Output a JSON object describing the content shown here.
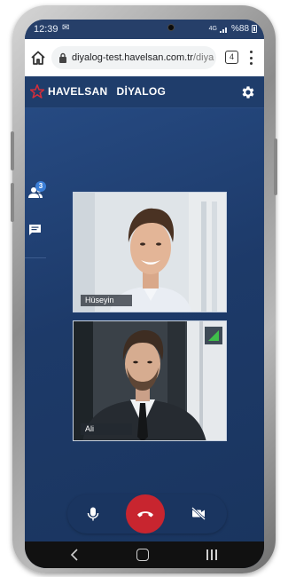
{
  "status_bar": {
    "time": "12:39",
    "message_indicator": "✉",
    "network": "4G",
    "battery": "%88"
  },
  "browser": {
    "url_host": "diyalog-test.havelsan.com.tr",
    "url_path": "/diya",
    "tab_count": "4"
  },
  "app": {
    "brand": "HAVELSAN",
    "product": "DİYALOG"
  },
  "sidebar": {
    "participants_count": "3"
  },
  "participants": [
    {
      "name": "Hüseyin"
    },
    {
      "name": "Ali"
    }
  ],
  "colors": {
    "app_background": "#1d3a66",
    "hangup": "#c8252f",
    "badge": "#3b7fd8",
    "signal": "#3fbf4a"
  },
  "icons": {
    "home": "home-icon",
    "lock": "lock-icon",
    "settings": "gear-icon",
    "participants": "people-icon",
    "chat": "chat-icon",
    "mic": "microphone-icon",
    "hangup": "phone-hangup-icon",
    "camera_off": "video-off-icon",
    "signal": "signal-strength-icon"
  }
}
